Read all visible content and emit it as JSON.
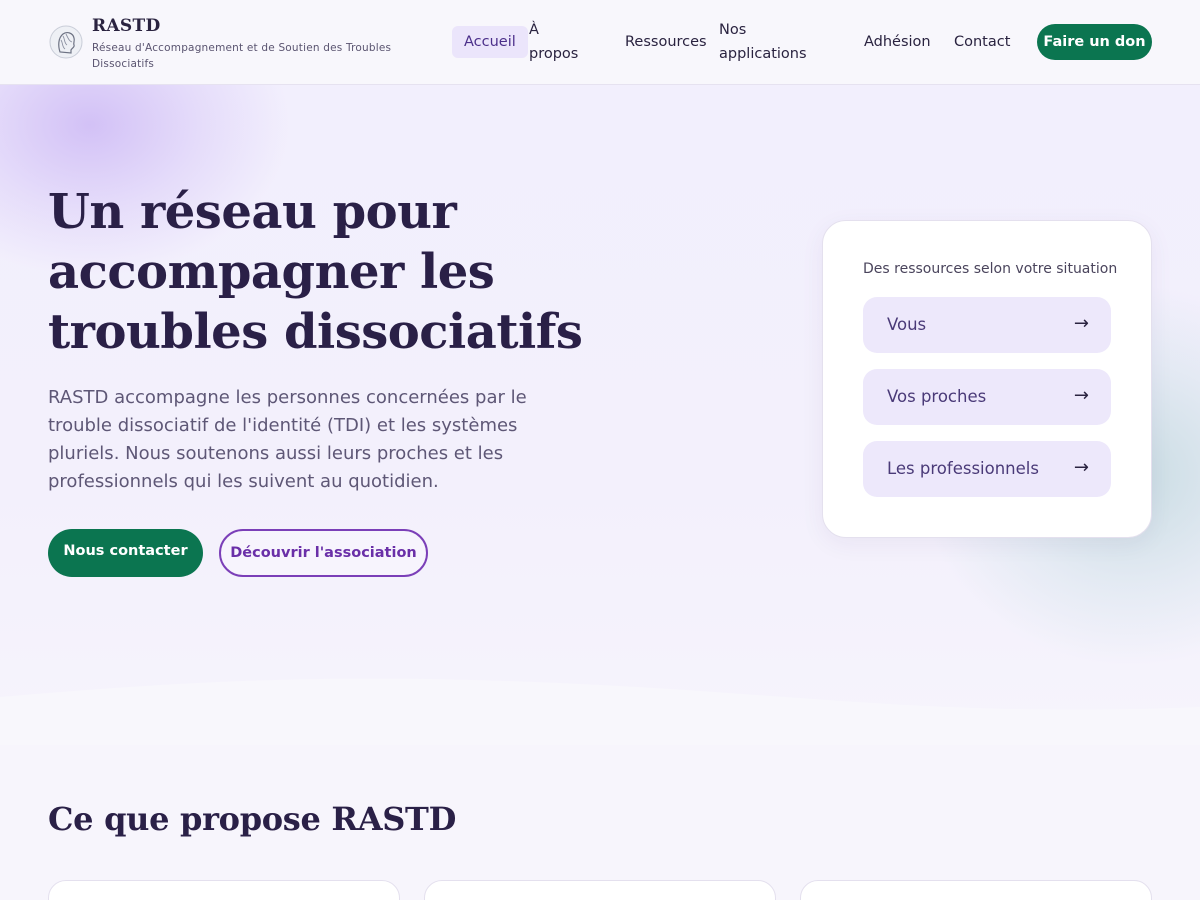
{
  "header": {
    "brand_name": "RASTD",
    "brand_tagline": "Réseau d'Accompagnement et de Soutien des Troubles Dissociatifs",
    "logo_icon": "profile-silhouette-logo",
    "nav": [
      {
        "label": "Accueil",
        "active": true
      },
      {
        "label": "À propos",
        "active": false
      },
      {
        "label": "Ressources",
        "active": false
      },
      {
        "label": "Nos applications",
        "active": false
      },
      {
        "label": "Adhésion",
        "active": false
      },
      {
        "label": "Contact",
        "active": false
      }
    ],
    "donate_label": "Faire un don"
  },
  "hero": {
    "title": "Un réseau pour accompagner les troubles dissociatifs",
    "description": "RASTD accompagne les personnes concernées par le trouble dissociatif de l'identité (TDI) et les systèmes pluriels. Nous soutenons aussi leurs proches et les professionnels qui les suivent au quotidien.",
    "primary_cta": "Nous contacter",
    "secondary_cta": "Découvrir l'association"
  },
  "resources_card": {
    "title": "Des ressources selon votre situation",
    "items": [
      {
        "label": "Vous",
        "arrow": "→"
      },
      {
        "label": "Vos proches",
        "arrow": "→"
      },
      {
        "label": "Les professionnels",
        "arrow": "→"
      }
    ]
  },
  "section": {
    "title": "Ce que propose RASTD"
  },
  "colors": {
    "primary_green": "#0b7550",
    "accent_purple": "#7b3fb8",
    "heading": "#2a2047",
    "soft_lavender": "#ede8fb"
  }
}
